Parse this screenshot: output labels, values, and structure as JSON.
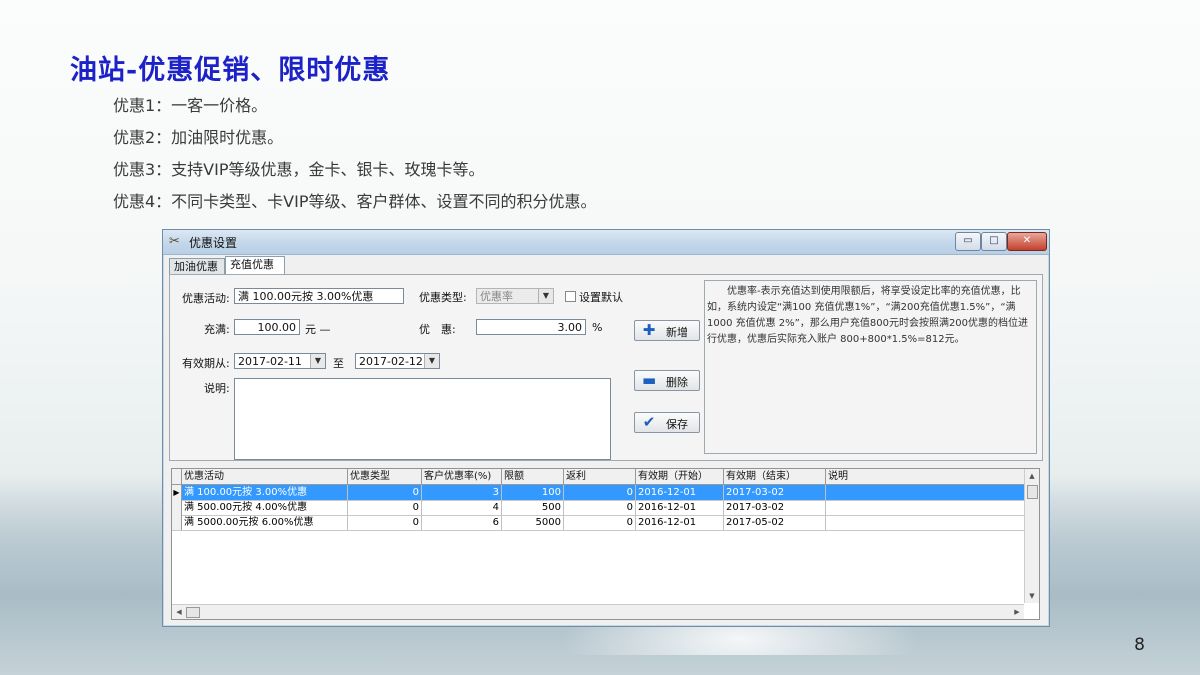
{
  "slide": {
    "title": "油站-优惠促销、限时优惠",
    "bullets": [
      "优惠1：一客一价格。",
      "优惠2：加油限时优惠。",
      "优惠3：支持VIP等级优惠，金卡、银卡、玫瑰卡等。",
      "优惠4：不同卡类型、卡VIP等级、客户群体、设置不同的积分优惠。"
    ],
    "page_number": "8"
  },
  "window": {
    "title": "优惠设置",
    "min_glyph": "▭",
    "max_glyph": "□",
    "close_glyph": "✕",
    "tabs": [
      {
        "label": "加油优惠"
      },
      {
        "label": "充值优惠"
      }
    ],
    "form": {
      "activity_label": "优惠活动:",
      "activity_value": "满 100.00元按 3.00%优惠",
      "type_label": "优惠类型:",
      "type_value": "优惠率",
      "default_label": "设置默认",
      "full_label": "充满:",
      "full_value": "100.00",
      "full_unit": "元 —",
      "discount_label": "优　惠:",
      "discount_value": "3.00",
      "discount_unit": "%",
      "valid_from_label": "有效期从:",
      "valid_from": "2017-02-11",
      "to_label": "至",
      "valid_to": "2017-02-12",
      "desc_label": "说明:"
    },
    "buttons": {
      "add": "新增",
      "delete": "删除",
      "save": "保存"
    },
    "info_text": "　　优惠率-表示充值达到使用限额后，将享受设定比率的充值优惠，比如，系统内设定“满100 充值优惠1%”，“满200充值优惠1.5%”，“满1000 充值优惠 2%”，那么用户充值800元时会按照满200优惠的档位进行优惠，优惠后实际充入账户 800+800*1.5%=812元。",
    "grid": {
      "columns": [
        "优惠活动",
        "优惠类型",
        "客户优惠率(%)",
        "限额",
        "返利",
        "有效期（开始）",
        "有效期（结束）",
        "说明"
      ],
      "rows": [
        [
          "满 100.00元按 3.00%优惠",
          "0",
          "3",
          "100",
          "0",
          "2016-12-01",
          "2017-03-02",
          ""
        ],
        [
          "满 500.00元按 4.00%优惠",
          "0",
          "4",
          "500",
          "0",
          "2016-12-01",
          "2017-03-02",
          ""
        ],
        [
          "满 5000.00元按 6.00%优惠",
          "0",
          "6",
          "5000",
          "0",
          "2016-12-01",
          "2017-05-02",
          ""
        ]
      ],
      "selected_row": 0
    }
  },
  "colors": {
    "title": "#1d22c8",
    "selection": "#3399ff"
  }
}
